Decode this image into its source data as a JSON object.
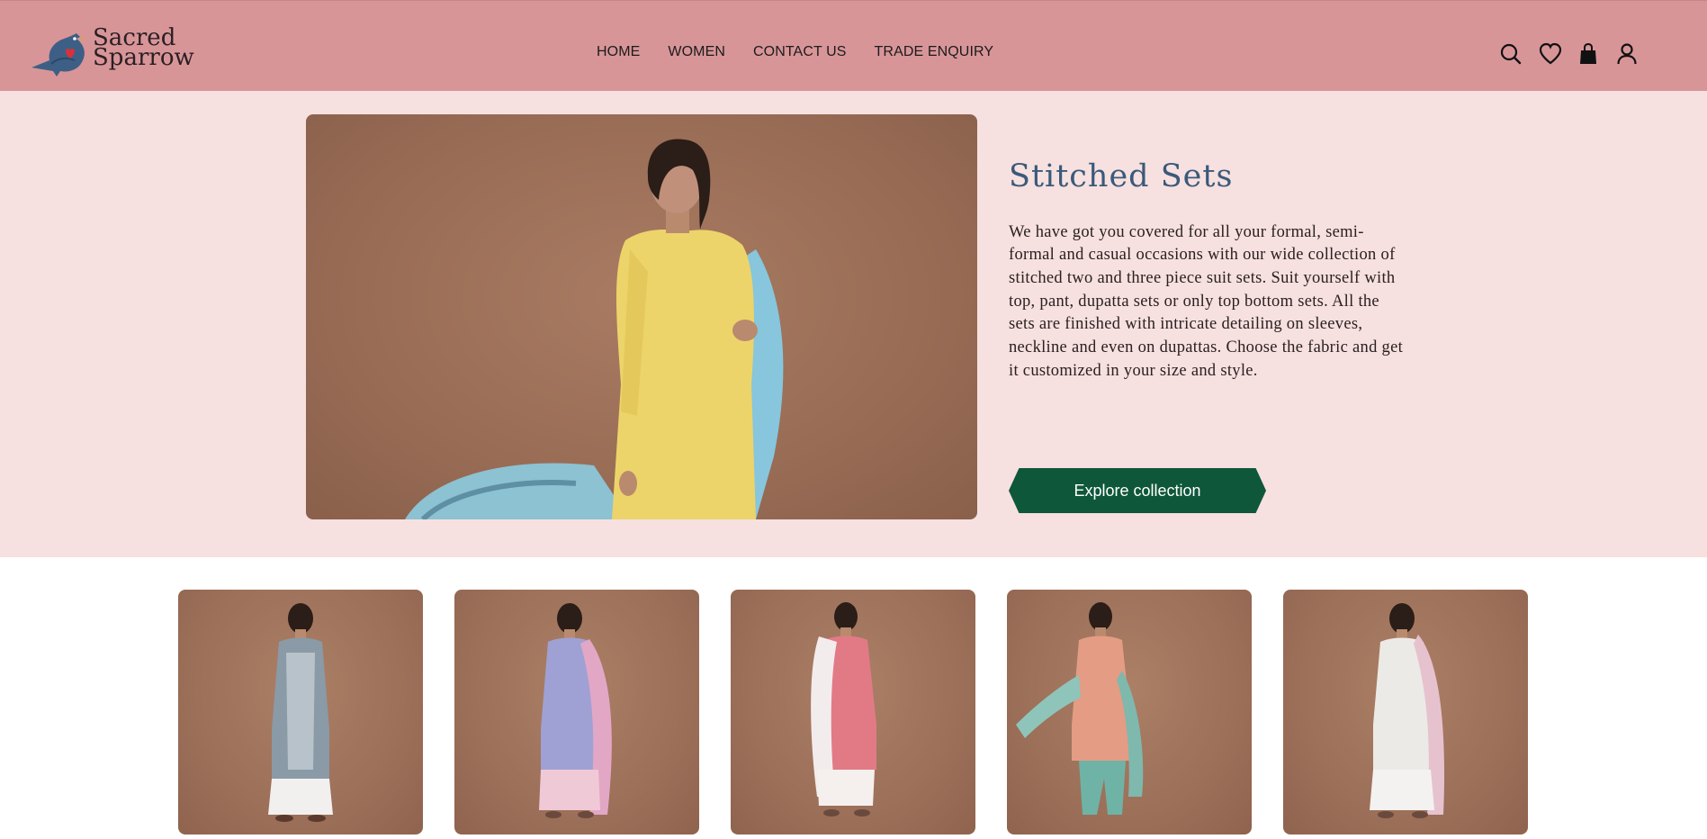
{
  "brand": {
    "line1": "Sacred",
    "line2": "Sparrow"
  },
  "nav": [
    {
      "label": "HOME"
    },
    {
      "label": "WOMEN"
    },
    {
      "label": "CONTACT US"
    },
    {
      "label": "TRADE ENQUIRY"
    }
  ],
  "icons": [
    "search-icon",
    "heart-icon",
    "bag-icon",
    "user-icon"
  ],
  "hero": {
    "title": "Stitched Sets",
    "description": "We have got you covered for all your formal, semi-formal and casual occasions with our wide collection of stitched two and three piece suit sets. Suit yourself with top, pant, dupatta sets or only top bottom sets. All the sets are finished with intricate detailing on sleeves, neckline and even on dupattas. Choose the fabric and get it customized in your size and style.",
    "button_label": "Explore collection"
  },
  "colors": {
    "header_bg": "#d89598",
    "hero_bg": "#f7e0e0",
    "title": "#3a5a7a",
    "button_bg": "#0e573a"
  }
}
